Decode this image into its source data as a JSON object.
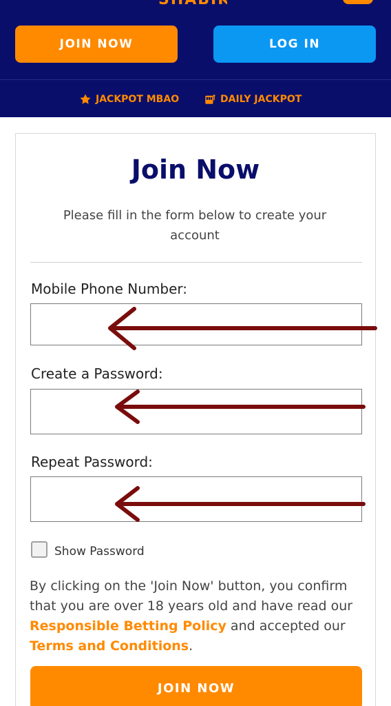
{
  "header": {
    "join_label": "JOIN NOW",
    "login_label": "LOG IN"
  },
  "subnav": [
    {
      "label": "JACKPOT MBAO",
      "icon": "star-icon"
    },
    {
      "label": "DAILY JACKPOT",
      "icon": "slot-machine-icon"
    }
  ],
  "form": {
    "title": "Join Now",
    "subtitle": "Please fill in the form below to create your account",
    "phone_label": "Mobile Phone Number:",
    "password_label": "Create a Password:",
    "repeat_label": "Repeat Password:",
    "show_password_label": "Show Password",
    "legal_prefix": "By clicking on the 'Join Now' button, you confirm that you are over 18 years old and have read our ",
    "legal_link1": "Responsible Betting Policy",
    "legal_middle": " and accepted our ",
    "legal_link2": "Terms and Conditions",
    "legal_suffix": ".",
    "submit_label": "JOIN NOW"
  },
  "colors": {
    "navy": "#0a0e6b",
    "orange": "#ff8a00",
    "blue": "#0a98f2",
    "annotation_arrow": "#7a0c0c"
  }
}
